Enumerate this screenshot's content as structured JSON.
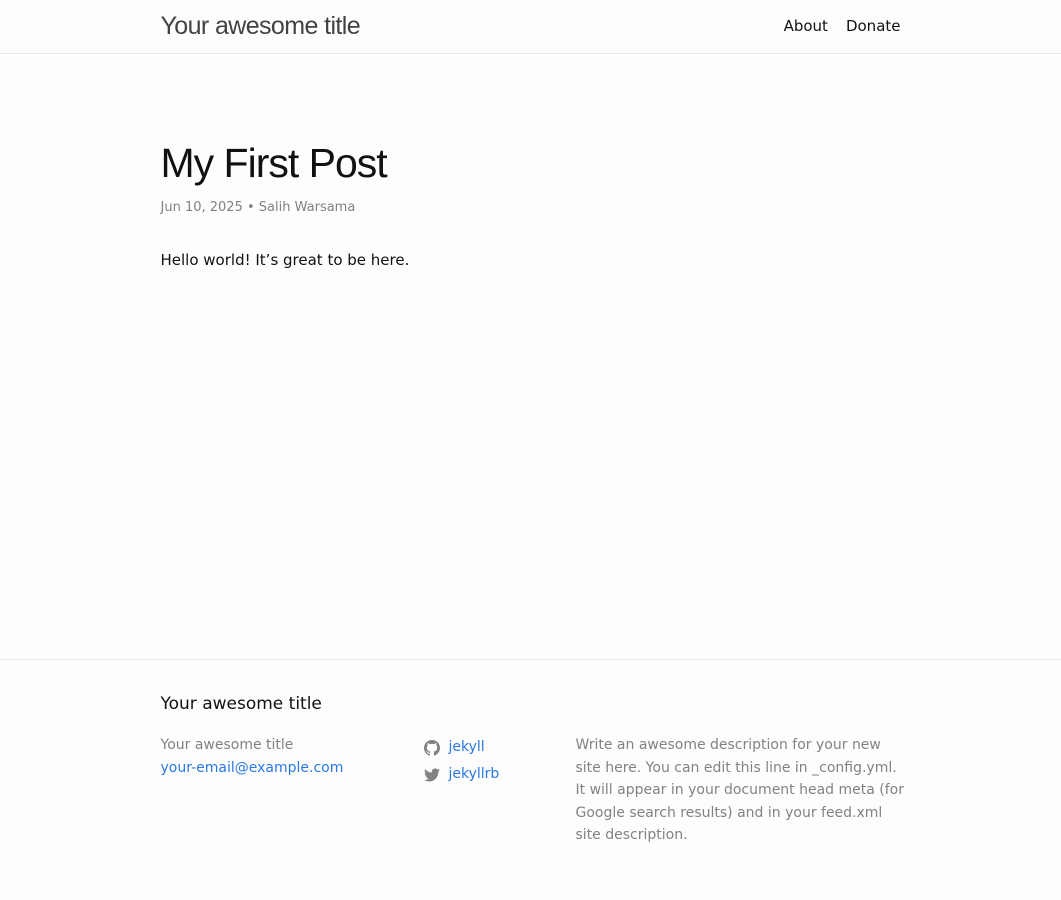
{
  "header": {
    "site_title": "Your awesome title",
    "nav": [
      {
        "label": "About"
      },
      {
        "label": "Donate"
      }
    ]
  },
  "post": {
    "title": "My First Post",
    "date": "Jun 10, 2025",
    "separator": "•",
    "author": "Salih Warsama",
    "body": "Hello world! It’s great to be here."
  },
  "footer": {
    "heading": "Your awesome title",
    "site_name": "Your awesome title",
    "email": "your-email@example.com",
    "social": [
      {
        "icon": "github-icon",
        "label": "jekyll"
      },
      {
        "icon": "twitter-icon",
        "label": "jekyllrb"
      }
    ],
    "description": "Write an awesome description for your new site here. You can edit this line in _config.yml. It will appear in your document head meta (for Google search results) and in your feed.xml site description."
  },
  "colors": {
    "link": "#2a7ae2",
    "muted": "#828282",
    "text": "#111111",
    "background": "#fdfdfd",
    "border": "#e8e8e8"
  }
}
